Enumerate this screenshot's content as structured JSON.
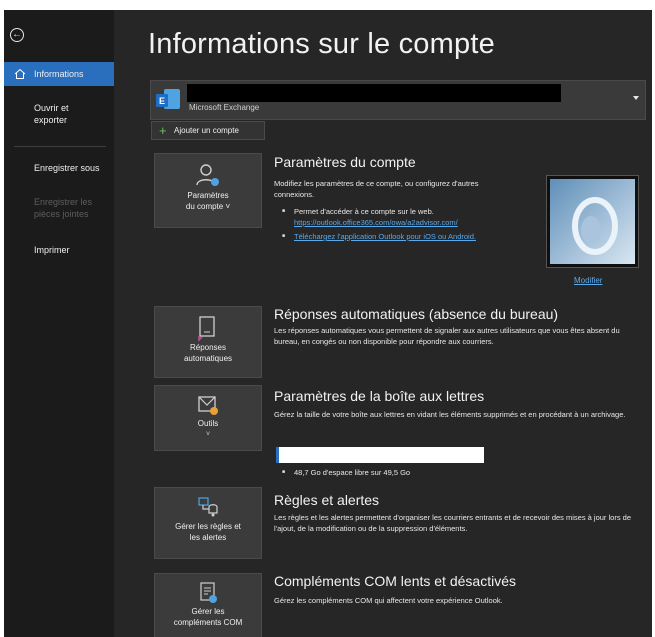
{
  "sidebar": {
    "items": [
      {
        "label": "Informations",
        "active": true
      },
      {
        "label": "Ouvrir et exporter"
      },
      {
        "label": "Enregistrer sous"
      },
      {
        "label": "Enregistrer les pièces jointes",
        "disabled": true
      },
      {
        "label": "Imprimer"
      }
    ]
  },
  "header": {
    "title": "Informations sur le compte"
  },
  "account": {
    "type": "Microsoft Exchange",
    "add_label": "Ajouter un compte"
  },
  "sections": {
    "account_settings": {
      "tile_label_1": "Paramètres",
      "tile_label_2": "du compte ˅",
      "title": "Paramètres du compte",
      "desc": "Modifiez les paramètres de ce compte, ou configurez d'autres connexions.",
      "bullet1": "Permet d'accéder à ce compte sur le web.",
      "bullet1_link": "https://outlook.office365.com/owa/a2advisor.com/",
      "bullet2_link": "Téléchargez l'application Outlook pour iOS ou Android.",
      "modify_label": "Modifier"
    },
    "auto_replies": {
      "tile_label_1": "Réponses",
      "tile_label_2": "automatiques",
      "title": "Réponses automatiques (absence du bureau)",
      "desc": "Les réponses automatiques vous permettent de signaler aux autres utilisateurs que vous êtes absent du bureau, en congés ou non disponible pour répondre aux courriers."
    },
    "mailbox": {
      "tile_label": "Outils",
      "title": "Paramètres de la boîte aux lettres",
      "desc": "Gérez la taille de votre boîte aux lettres en vidant les éléments supprimés et en procédant à un archivage.",
      "storage_text": "48,7 Go d'espace libre sur 49,5 Go",
      "used_fraction": 0.016
    },
    "rules": {
      "tile_label_1": "Gérer les règles et",
      "tile_label_2": "les alertes",
      "title": "Règles et alertes",
      "desc": "Les règles et les alertes permettent d'organiser les courriers entrants et de recevoir des mises à jour lors de l'ajout, de la modification ou de la suppression d'éléments."
    },
    "com": {
      "tile_label_1": "Gérer les",
      "tile_label_2": "compléments COM",
      "title": "Compléments COM lents et désactivés",
      "desc": "Gérez les compléments COM qui affectent votre expérience Outlook."
    }
  },
  "colors": {
    "accent": "#2a6ebe",
    "background": "#262626",
    "sidebar": "#1b1b1b",
    "link": "#5aa9ea"
  }
}
